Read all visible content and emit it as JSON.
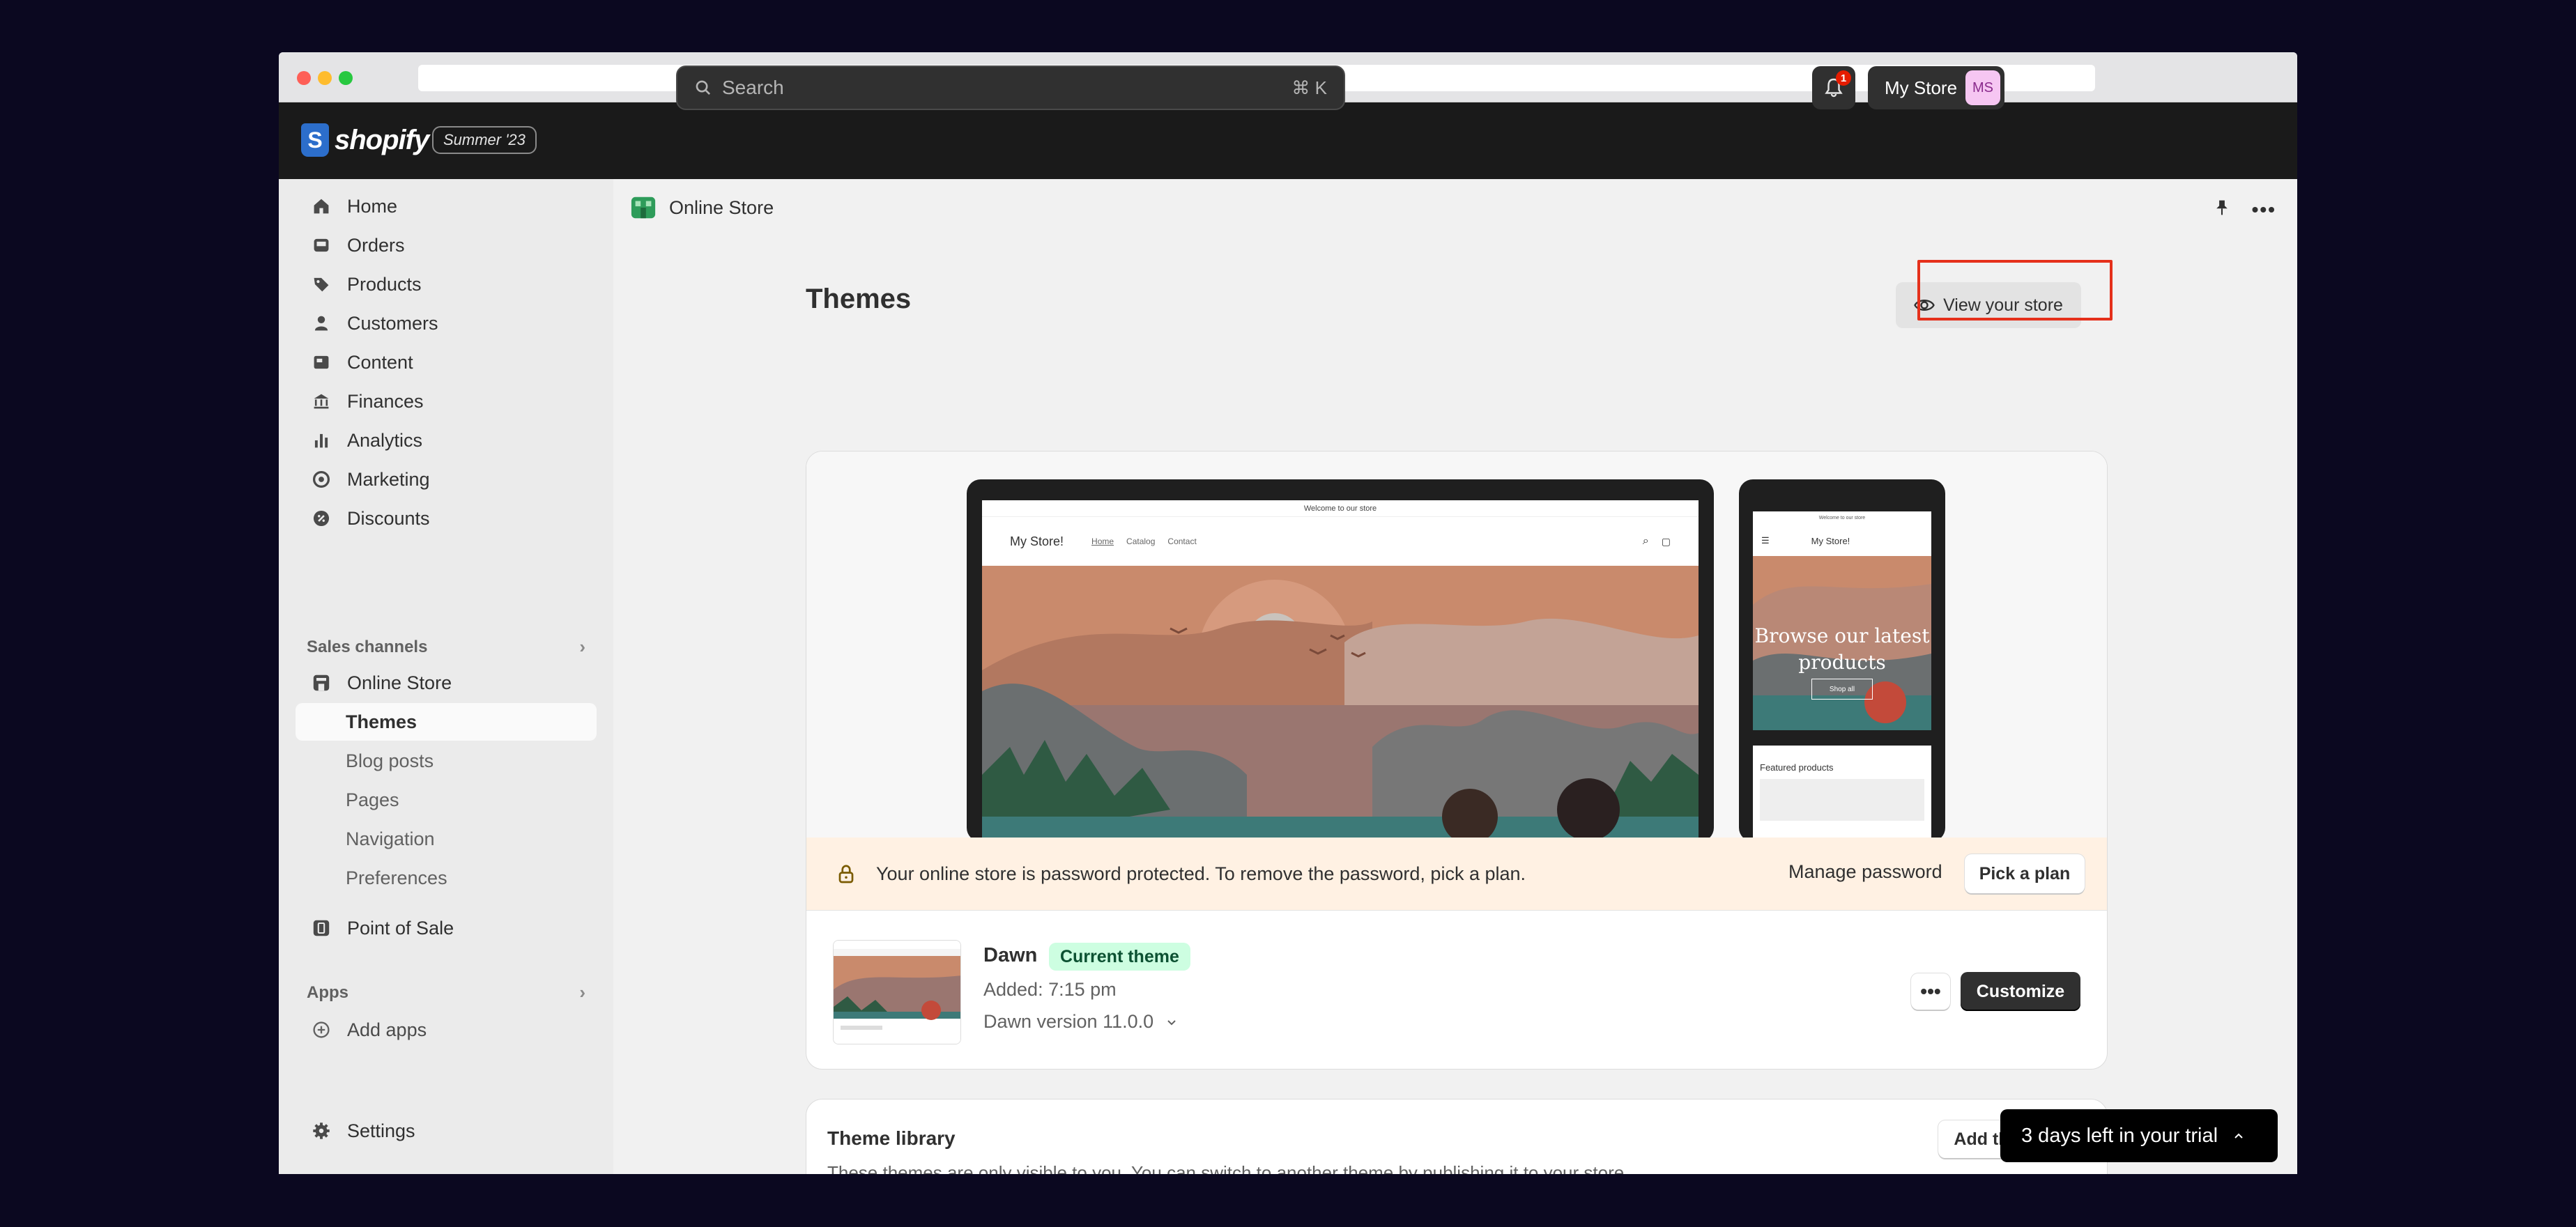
{
  "brand": {
    "name": "shopify",
    "edition": "Summer '23"
  },
  "search": {
    "placeholder": "Search",
    "shortcut": "⌘ K"
  },
  "notifications": {
    "count": "1"
  },
  "store": {
    "name": "My Store",
    "initials": "MS"
  },
  "sidebar": {
    "items": [
      {
        "label": "Home",
        "icon": "home-icon"
      },
      {
        "label": "Orders",
        "icon": "inbox-icon"
      },
      {
        "label": "Products",
        "icon": "tag-icon"
      },
      {
        "label": "Customers",
        "icon": "person-icon"
      },
      {
        "label": "Content",
        "icon": "image-icon"
      },
      {
        "label": "Finances",
        "icon": "bank-icon"
      },
      {
        "label": "Analytics",
        "icon": "bar-chart-icon"
      },
      {
        "label": "Marketing",
        "icon": "target-icon"
      },
      {
        "label": "Discounts",
        "icon": "discount-icon"
      }
    ],
    "sales_channels_label": "Sales channels",
    "online_store": "Online Store",
    "sub_items": [
      "Themes",
      "Blog posts",
      "Pages",
      "Navigation",
      "Preferences"
    ],
    "point_of_sale": "Point of Sale",
    "apps_label": "Apps",
    "add_apps": "Add apps",
    "settings": "Settings"
  },
  "breadcrumb": {
    "label": "Online Store"
  },
  "page": {
    "title": "Themes",
    "view_store": "View your store"
  },
  "preview": {
    "announcement": "Welcome to our store",
    "store_title": "My Store!",
    "nav_links": [
      "Home",
      "Catalog",
      "Contact"
    ],
    "phone_hero": "Browse our latest products",
    "phone_button": "Shop all",
    "featured": "Featured products"
  },
  "banner": {
    "message": "Your online store is password protected. To remove the password, pick a plan.",
    "manage": "Manage password",
    "pick_plan": "Pick a plan"
  },
  "current_theme": {
    "name": "Dawn",
    "badge": "Current theme",
    "added": "Added: 7:15 pm",
    "version": "Dawn version 11.0.0",
    "customize": "Customize"
  },
  "library": {
    "title": "Theme library",
    "description": "These themes are only visible to you. You can switch to another theme by publishing it to your store.",
    "add_theme": "Add theme"
  },
  "trial": {
    "label": "3 days left in your trial"
  },
  "colors": {
    "topbar": "#1a1a1a",
    "accent_badge": "#cdfee1",
    "banner": "#fff1e3",
    "highlight": "#e5301b"
  }
}
